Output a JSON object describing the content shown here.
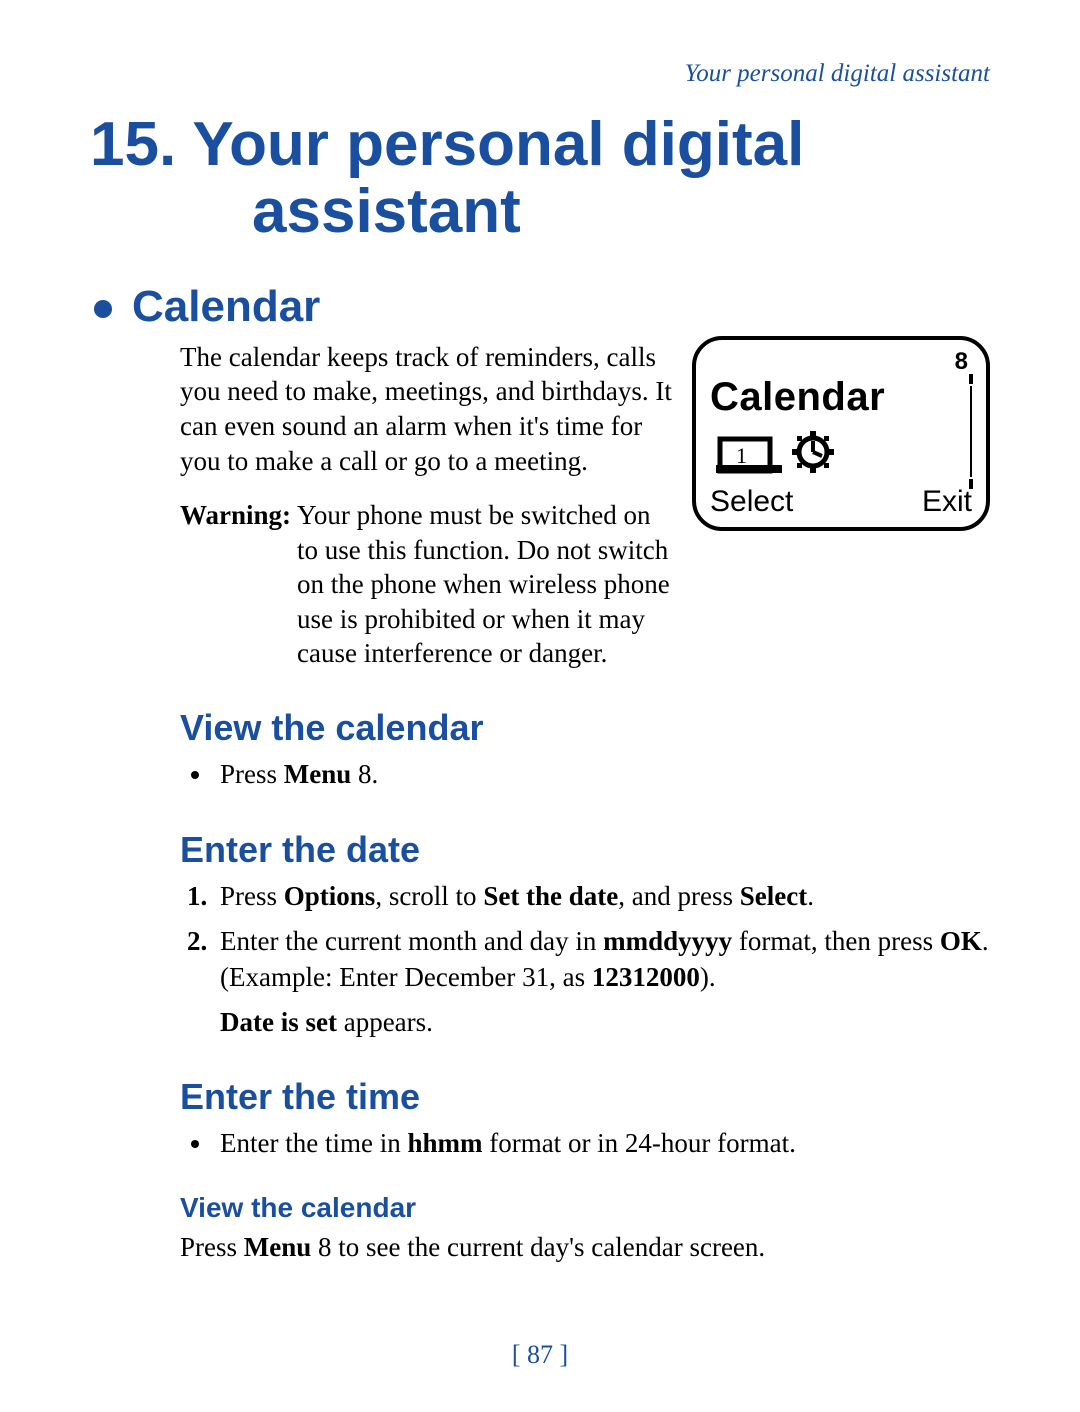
{
  "running_head": "Your personal digital assistant",
  "chapter": {
    "number": "15.",
    "title_line1": "Your personal digital",
    "title_line2": "assistant"
  },
  "section_calendar": {
    "heading": "Calendar",
    "intro": "The calendar keeps track of reminders, calls you need to make, meetings, and birthdays. It can even sound an alarm when it's time for you to make a call or go to a meeting.",
    "warning_label": "Warning:",
    "warning_text": "Your phone must be switched on to use this function. Do not switch on the phone when wireless phone use is prohibited or when it may cause interference or danger."
  },
  "phone_screen": {
    "menu_index": "8",
    "title": "Calendar",
    "softkey_left": "Select",
    "softkey_right": "Exit"
  },
  "view_calendar": {
    "heading": "View the calendar",
    "bullet_prefix": "Press ",
    "bullet_bold": "Menu",
    "bullet_suffix": " 8."
  },
  "enter_date": {
    "heading": "Enter the date",
    "step1_a": "Press ",
    "step1_b": "Options",
    "step1_c": ", scroll to ",
    "step1_d": "Set the date",
    "step1_e": ", and press ",
    "step1_f": "Select",
    "step1_g": ".",
    "step2_a": "Enter the current month and day in ",
    "step2_b": "mmddyyyy",
    "step2_c": " format, then press ",
    "step2_d": "OK",
    "step2_e": ". (Example:  Enter December 31, as ",
    "step2_f": "12312000",
    "step2_g": ").",
    "confirm_a": "Date is set",
    "confirm_b": " appears."
  },
  "enter_time": {
    "heading": "Enter the time",
    "bullet_a": "Enter the time in ",
    "bullet_b": "hhmm",
    "bullet_c": " format or in 24-hour format."
  },
  "view_calendar2": {
    "heading": "View the calendar",
    "text_a": "Press ",
    "text_b": "Menu",
    "text_c": " 8 to see the current day's calendar screen."
  },
  "page_number": "[ 87 ]"
}
